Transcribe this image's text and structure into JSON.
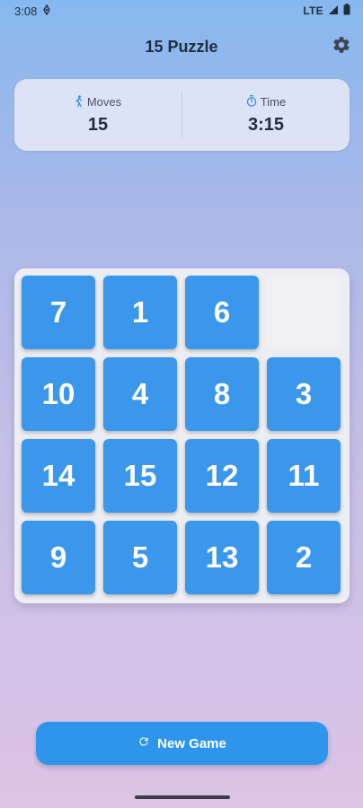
{
  "status_bar": {
    "time": "3:08",
    "network": "LTE",
    "icons": [
      "notification-icon",
      "signal-icon",
      "battery-icon"
    ]
  },
  "header": {
    "title": "15 Puzzle",
    "settings_icon": "gear-icon"
  },
  "stats": {
    "moves_label": "Moves",
    "moves_value": "15",
    "moves_icon": "walking-icon",
    "time_label": "Time",
    "time_value": "3:15",
    "time_icon": "timer-icon"
  },
  "board": {
    "tiles": [
      [
        "7",
        "1",
        "6",
        ""
      ],
      [
        "10",
        "4",
        "8",
        "3"
      ],
      [
        "14",
        "15",
        "12",
        "11"
      ],
      [
        "9",
        "5",
        "13",
        "2"
      ]
    ]
  },
  "actions": {
    "new_game_label": "New Game",
    "new_game_icon": "refresh-icon"
  },
  "colors": {
    "tile": "#3a97ec",
    "accent": "#2e95ec",
    "board_bg": "#eceef3",
    "empty_tile": "#f1f1f3"
  }
}
